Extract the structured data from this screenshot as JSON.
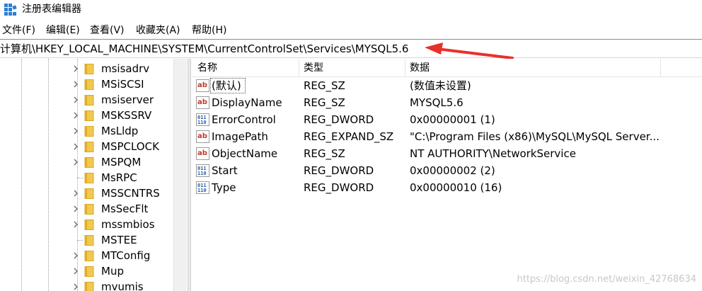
{
  "window": {
    "title": "注册表编辑器",
    "icon": "regedit-app-icon"
  },
  "menu": [
    {
      "label": "文件(F)"
    },
    {
      "label": "编辑(E)"
    },
    {
      "label": "查看(V)"
    },
    {
      "label": "收藏夹(A)"
    },
    {
      "label": "帮助(H)"
    }
  ],
  "address": {
    "path": "计算机\\HKEY_LOCAL_MACHINE\\SYSTEM\\CurrentControlSet\\Services\\MYSQL5.6",
    "annotation_color": "#e8312a"
  },
  "tree": {
    "items": [
      {
        "label": "msisadrv",
        "expandable": true
      },
      {
        "label": "MSiSCSI",
        "expandable": true
      },
      {
        "label": "msiserver",
        "expandable": true
      },
      {
        "label": "MSKSSRV",
        "expandable": true
      },
      {
        "label": "MsLldp",
        "expandable": true
      },
      {
        "label": "MSPCLOCK",
        "expandable": true
      },
      {
        "label": "MSPQM",
        "expandable": true
      },
      {
        "label": "MsRPC",
        "expandable": false
      },
      {
        "label": "MSSCNTRS",
        "expandable": true
      },
      {
        "label": "MsSecFlt",
        "expandable": true
      },
      {
        "label": "mssmbios",
        "expandable": true
      },
      {
        "label": "MSTEE",
        "expandable": false
      },
      {
        "label": "MTConfig",
        "expandable": true
      },
      {
        "label": "Mup",
        "expandable": true
      },
      {
        "label": "mvumis",
        "expandable": true
      }
    ]
  },
  "list": {
    "columns": {
      "name": "名称",
      "type": "类型",
      "data": "数据"
    },
    "rows": [
      {
        "icon": "string-value-icon",
        "name": "(默认)",
        "type": "REG_SZ",
        "data": "(数值未设置)",
        "focused": true
      },
      {
        "icon": "string-value-icon",
        "name": "DisplayName",
        "type": "REG_SZ",
        "data": "MYSQL5.6"
      },
      {
        "icon": "binary-value-icon",
        "name": "ErrorControl",
        "type": "REG_DWORD",
        "data": "0x00000001 (1)"
      },
      {
        "icon": "string-value-icon",
        "name": "ImagePath",
        "type": "REG_EXPAND_SZ",
        "data": "\"C:\\Program Files (x86)\\MySQL\\MySQL Server..."
      },
      {
        "icon": "string-value-icon",
        "name": "ObjectName",
        "type": "REG_SZ",
        "data": "NT AUTHORITY\\NetworkService"
      },
      {
        "icon": "binary-value-icon",
        "name": "Start",
        "type": "REG_DWORD",
        "data": "0x00000002 (2)"
      },
      {
        "icon": "binary-value-icon",
        "name": "Type",
        "type": "REG_DWORD",
        "data": "0x00000010 (16)"
      }
    ]
  },
  "watermark": "https://blog.csdn.net/weixin_42768634",
  "colors": {
    "folder": "#f2c94c",
    "string_icon_red": "#c0392b",
    "binary_icon_blue": "#2b5fa8"
  }
}
